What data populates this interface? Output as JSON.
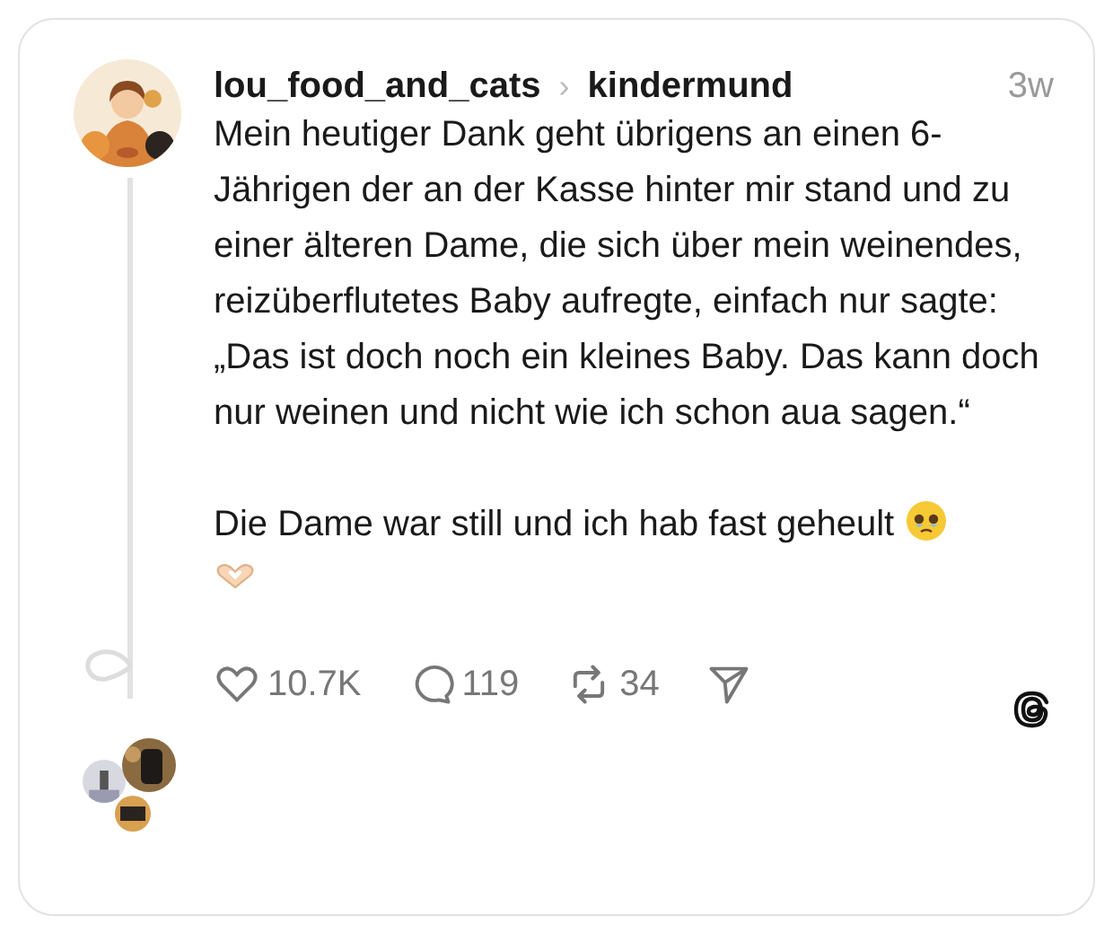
{
  "post": {
    "author": "lou_food_and_cats",
    "separator": "›",
    "topic": "kindermund",
    "time": "3w",
    "paragraphs": [
      "Mein heutiger Dank geht übrigens an einen 6-Jährigen der an der Kasse hinter mir stand und zu einer älteren Dame, die sich über mein weinendes, reizüberflutetes Baby aufregte, einfach nur sagte:",
      "„Das ist doch noch ein kleines Baby. Das kann doch nur weinen und nicht wie ich schon aua sagen.“",
      "Die Dame war still und ich hab fast geheult"
    ],
    "actions": [
      {
        "kind": "like",
        "count": "10.7K"
      },
      {
        "kind": "reply",
        "count": "119"
      },
      {
        "kind": "repost",
        "count": "34"
      },
      {
        "kind": "share"
      }
    ]
  }
}
